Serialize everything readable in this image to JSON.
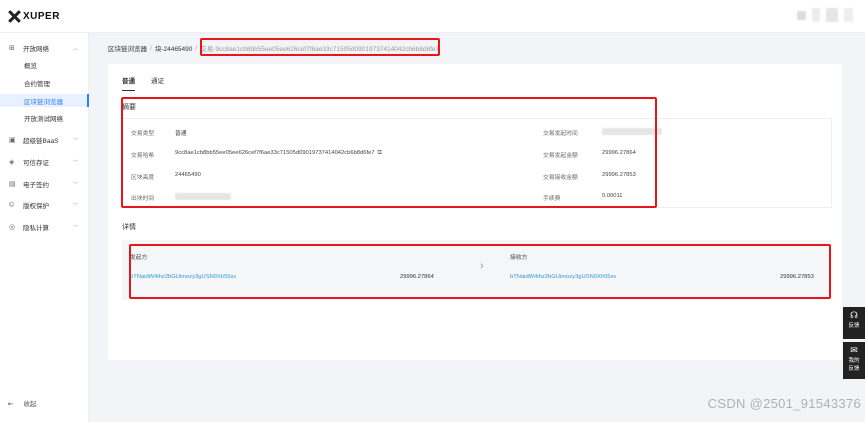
{
  "app": {
    "logo_text": "XUPER"
  },
  "sidebar": {
    "groups": [
      {
        "label": "开放网络",
        "icon": "grid-icon"
      },
      {
        "label": "超级链BaaS",
        "icon": "cube-icon"
      },
      {
        "label": "可信存证",
        "icon": "shield-icon"
      },
      {
        "label": "电子签约",
        "icon": "sign-icon"
      },
      {
        "label": "版权保护",
        "icon": "copyright-icon"
      },
      {
        "label": "隐私计算",
        "icon": "privacy-icon"
      }
    ],
    "subitems": [
      {
        "label": "概览"
      },
      {
        "label": "合约管理"
      },
      {
        "label": "区块链浏览器"
      },
      {
        "label": "开放测试网络"
      }
    ],
    "collapse_label": "收起"
  },
  "breadcrumb": {
    "root": "区块链浏览器",
    "block": "块-24465490",
    "current": "交易-9cc8ae1cb8bb55ee05ee626cef7f6ae33c71505d09019737414042cb6b8d6fe7"
  },
  "tabs": [
    {
      "label": "普通"
    },
    {
      "label": "通证"
    }
  ],
  "summary": {
    "title": "摘要",
    "left": [
      {
        "key": "交易类型",
        "value": "普通"
      },
      {
        "key": "交易哈希",
        "value": "9cc8ae1cb8bb55ee05ee626cef7f6ae33c71505d09019737414042cb6b8d6fe7"
      },
      {
        "key": "区块高度",
        "value": "24465490"
      },
      {
        "key": "出块时间",
        "value": ""
      }
    ],
    "right": [
      {
        "key": "交易发起时间",
        "value": ""
      },
      {
        "key": "交易发起金额",
        "value": "29996.27864"
      },
      {
        "key": "交易接收金额",
        "value": "29996.27853"
      },
      {
        "key": "手续费",
        "value": "0.00011"
      }
    ]
  },
  "details": {
    "title": "详情",
    "sender": {
      "header": "发起方",
      "address": "bTNaidW4ihz2bGUimozy3gUSN9Xh55sv",
      "amount": "29996.27864"
    },
    "receiver": {
      "header": "接收方",
      "address": "bTNaidW4ihz2bGUimozy3gUSN9Xh55sv",
      "amount": "29996.27853"
    }
  },
  "float": {
    "feedback": "反馈",
    "my_feedback_1": "我的",
    "my_feedback_2": "反馈"
  },
  "watermark": "CSDN @2501_91543376",
  "colors": {
    "accent": "#2f7ef7",
    "highlight": "#e6171c",
    "link": "#2f9bd6"
  }
}
